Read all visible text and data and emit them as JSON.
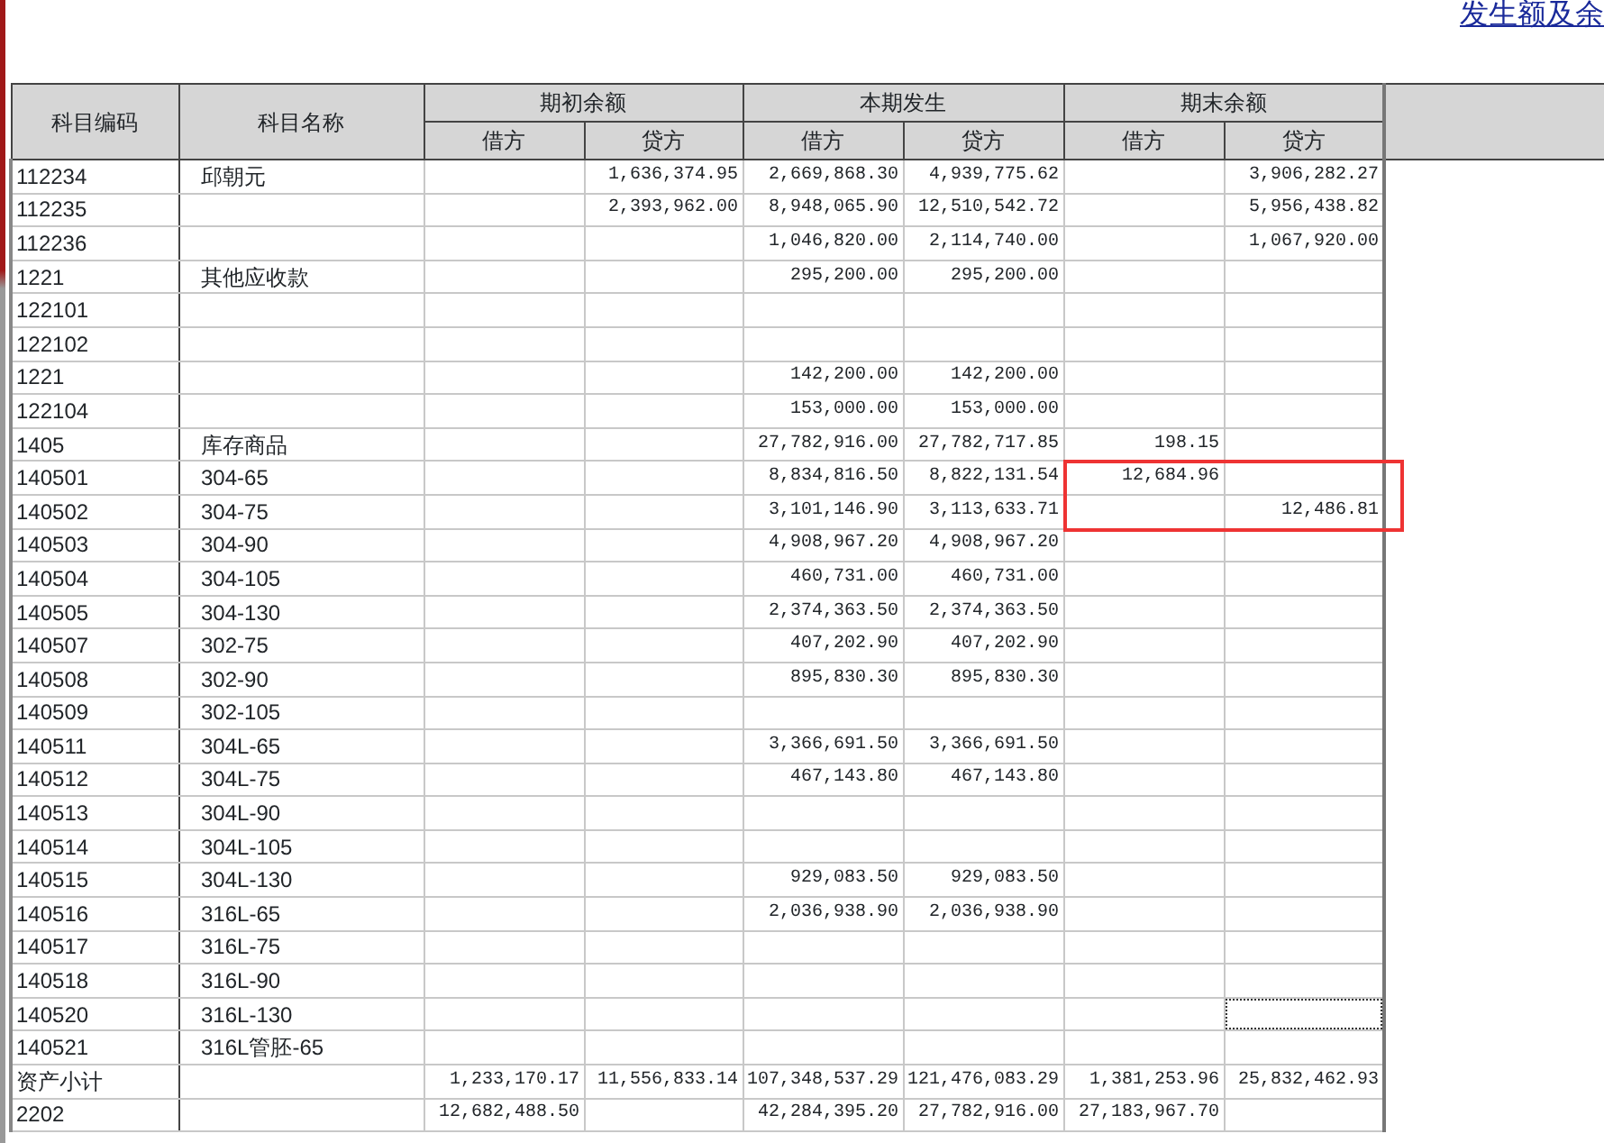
{
  "title_link": "发生额及余",
  "table": {
    "columns": [
      {
        "label": "科目编码"
      },
      {
        "label": "科目名称"
      },
      {
        "label": "期初余额",
        "sub": [
          "借方",
          "贷方"
        ]
      },
      {
        "label": "本期发生",
        "sub": [
          "借方",
          "贷方"
        ]
      },
      {
        "label": "期末余额",
        "sub": [
          "借方",
          "贷方"
        ]
      }
    ],
    "rows": [
      {
        "code": "112234",
        "name": "邱朝元",
        "opening_credit": "1,636,374.95",
        "period_debit": "2,669,868.30",
        "period_credit": "4,939,775.62",
        "closing_credit": "3,906,282.27"
      },
      {
        "code": "112235",
        "opening_credit": "2,393,962.00",
        "period_debit": "8,948,065.90",
        "period_credit": "12,510,542.72",
        "closing_credit": "5,956,438.82"
      },
      {
        "code": "112236",
        "period_debit": "1,046,820.00",
        "period_credit": "2,114,740.00",
        "closing_credit": "1,067,920.00"
      },
      {
        "code": "1221",
        "name": "其他应收款",
        "period_debit": "295,200.00",
        "period_credit": "295,200.00"
      },
      {
        "code": "122101"
      },
      {
        "code": "122102"
      },
      {
        "code": "1221",
        "period_debit": "142,200.00",
        "period_credit": "142,200.00"
      },
      {
        "code": "122104",
        "period_debit": "153,000.00",
        "period_credit": "153,000.00"
      },
      {
        "code": "1405",
        "name": "库存商品",
        "period_debit": "27,782,916.00",
        "period_credit": "27,782,717.85",
        "closing_debit": "198.15"
      },
      {
        "code": "140501",
        "name": "304-65",
        "period_debit": "8,834,816.50",
        "period_credit": "8,822,131.54",
        "closing_debit": "12,684.96",
        "annotated": true
      },
      {
        "code": "140502",
        "name": "304-75",
        "period_debit": "3,101,146.90",
        "period_credit": "3,113,633.71",
        "closing_credit": "12,486.81",
        "annotated": true
      },
      {
        "code": "140503",
        "name": "304-90",
        "period_debit": "4,908,967.20",
        "period_credit": "4,908,967.20"
      },
      {
        "code": "140504",
        "name": "304-105",
        "period_debit": "460,731.00",
        "period_credit": "460,731.00"
      },
      {
        "code": "140505",
        "name": "304-130",
        "period_debit": "2,374,363.50",
        "period_credit": "2,374,363.50"
      },
      {
        "code": "140507",
        "name": "302-75",
        "period_debit": "407,202.90",
        "period_credit": "407,202.90"
      },
      {
        "code": "140508",
        "name": "302-90",
        "period_debit": "895,830.30",
        "period_credit": "895,830.30"
      },
      {
        "code": "140509",
        "name": "302-105"
      },
      {
        "code": "140511",
        "name": "304L-65",
        "period_debit": "3,366,691.50",
        "period_credit": "3,366,691.50"
      },
      {
        "code": "140512",
        "name": "304L-75",
        "period_debit": "467,143.80",
        "period_credit": "467,143.80"
      },
      {
        "code": "140513",
        "name": "304L-90"
      },
      {
        "code": "140514",
        "name": "304L-105"
      },
      {
        "code": "140515",
        "name": "304L-130",
        "period_debit": "929,083.50",
        "period_credit": "929,083.50"
      },
      {
        "code": "140516",
        "name": "316L-65",
        "period_debit": "2,036,938.90",
        "period_credit": "2,036,938.90"
      },
      {
        "code": "140517",
        "name": "316L-75"
      },
      {
        "code": "140518",
        "name": "316L-90"
      },
      {
        "code": "140520",
        "name": "316L-130",
        "focused": true
      },
      {
        "code": "140521",
        "name": "316L管胚-65"
      },
      {
        "code": "资产小计",
        "opening_debit": "1,233,170.17",
        "opening_credit": "11,556,833.14",
        "period_debit": "107,348,537.29",
        "period_credit": "121,476,083.29",
        "closing_debit": "1,381,253.96",
        "closing_credit": "25,832,462.93"
      },
      {
        "code": "2202",
        "opening_debit": "12,682,488.50",
        "period_debit": "42,284,395.20",
        "period_credit": "27,782,916.00",
        "closing_debit": "27,183,967.70"
      }
    ]
  }
}
